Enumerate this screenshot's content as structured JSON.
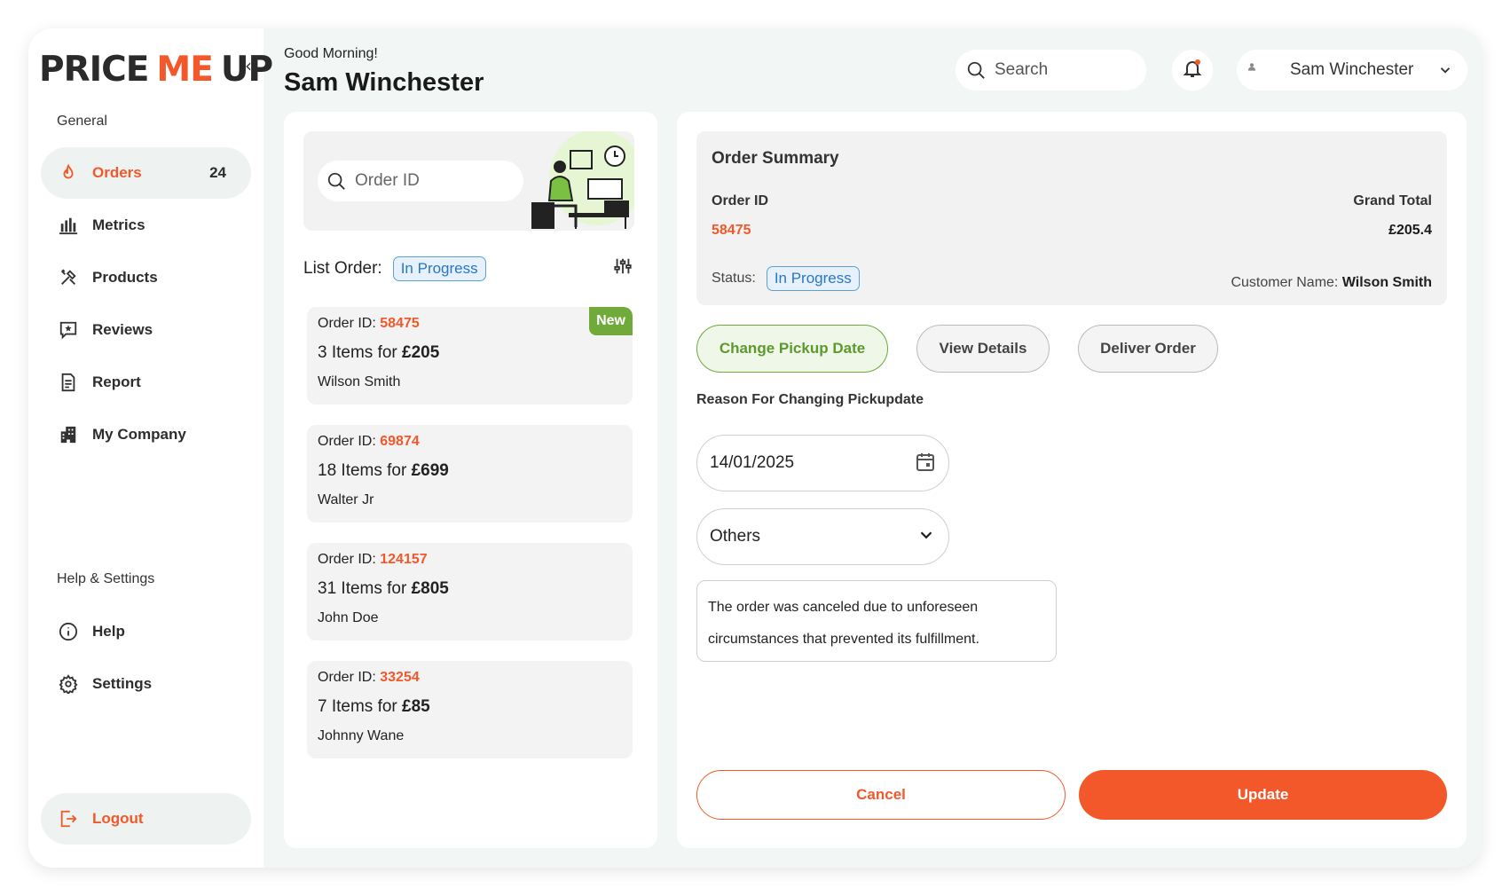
{
  "brand": {
    "logo_a": "PRICE",
    "logo_b": "ME",
    "logo_c": "UP",
    "accent": "#f2582a",
    "success": "#6faa3b",
    "info": "#2a76c8"
  },
  "sidebar": {
    "general_label": "General",
    "items": [
      {
        "label": "Orders",
        "count": "24",
        "icon": "fire-icon"
      },
      {
        "label": "Metrics",
        "icon": "bar-chart-icon"
      },
      {
        "label": "Products",
        "icon": "tools-icon"
      },
      {
        "label": "Reviews",
        "icon": "star-message-icon"
      },
      {
        "label": "Report",
        "icon": "document-icon"
      },
      {
        "label": "My Company",
        "icon": "building-icon"
      }
    ],
    "help_label": "Help & Settings",
    "help_items": [
      {
        "label": "Help",
        "icon": "info-icon"
      },
      {
        "label": "Settings",
        "icon": "gear-icon"
      }
    ],
    "logout_label": "Logout"
  },
  "header": {
    "greeting": "Good Morning!",
    "user_name": "Sam Winchester",
    "search_placeholder": "Search",
    "account_name": "Sam Winchester"
  },
  "order_list": {
    "search_placeholder": "Order ID",
    "list_label": "List Order:",
    "status_filter": "In Progress",
    "orders": [
      {
        "id_label": "Order ID:",
        "id": "58475",
        "items": "3 Items for ",
        "price": "£205",
        "customer": "Wilson Smith",
        "tag": "New"
      },
      {
        "id_label": "Order ID:",
        "id": "69874",
        "items": "18 Items for ",
        "price": "£699",
        "customer": "Walter Jr"
      },
      {
        "id_label": "Order ID:",
        "id": "124157",
        "items": "31 Items for ",
        "price": "£805",
        "customer": "John Doe"
      },
      {
        "id_label": "Order ID:",
        "id": "33254",
        "items": "7 Items for ",
        "price": "£85",
        "customer": "Johnny Wane"
      }
    ]
  },
  "summary": {
    "title": "Order Summary",
    "order_id_label": "Order ID",
    "order_id": "58475",
    "grand_total_label": "Grand Total",
    "grand_total": "£205.4",
    "status_label": "Status:",
    "status": "In Progress",
    "customer_label": "Customer Name:",
    "customer": "Wilson Smith"
  },
  "actions": {
    "change_pickup": "Change Pickup Date",
    "view_details": "View Details",
    "deliver": "Deliver Order"
  },
  "form": {
    "reason_label": "Reason For Changing Pickupdate",
    "date_value": "14/01/2025",
    "reason_select": "Others",
    "reason_text": "The order was canceled due to unforeseen circumstances that prevented its fulfillment.",
    "cancel_label": "Cancel",
    "update_label": "Update"
  }
}
